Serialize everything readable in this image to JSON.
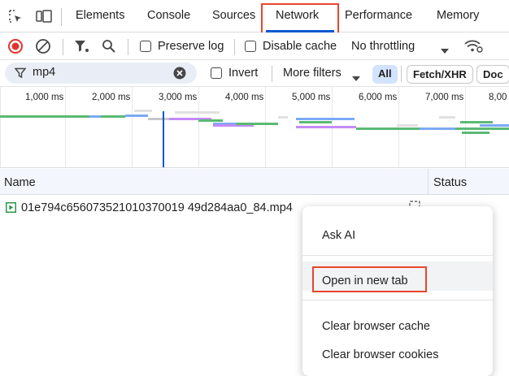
{
  "tabs": {
    "items": [
      {
        "label": "Elements"
      },
      {
        "label": "Console"
      },
      {
        "label": "Sources"
      },
      {
        "label": "Network"
      },
      {
        "label": "Performance"
      },
      {
        "label": "Memory"
      }
    ],
    "active": "Network"
  },
  "toolbar": {
    "preserve_log_label": "Preserve log",
    "preserve_log_checked": false,
    "disable_cache_label": "Disable cache",
    "disable_cache_checked": false,
    "throttling_value": "No throttling"
  },
  "filter": {
    "value": "mp4",
    "invert_label": "Invert",
    "invert_checked": false,
    "more_filters_label": "More filters",
    "types": [
      {
        "label": "All",
        "selected": true
      },
      {
        "label": "Fetch/XHR",
        "selected": false
      },
      {
        "label": "Doc",
        "selected": false
      }
    ]
  },
  "overview": {
    "ticks": [
      "1,000 ms",
      "2,000 ms",
      "3,000 ms",
      "4,000 ms",
      "5,000 ms",
      "6,000 ms",
      "7,000 ms",
      "8,00"
    ]
  },
  "table": {
    "columns": {
      "name": "Name",
      "status": "Status"
    },
    "rows": [
      {
        "name": "01e794c656073521010370019 49d284aa0_84.mp4"
      }
    ]
  },
  "context_menu": {
    "items": [
      {
        "label": "Ask AI"
      },
      {
        "label": "Open in new tab",
        "highlighted": true
      },
      {
        "label": "Clear browser cache"
      },
      {
        "label": "Clear browser cookies"
      }
    ]
  },
  "colors": {
    "accent": "#0b57d0",
    "highlight_box": "#e8452e",
    "record_red": "#dc362e",
    "bar_green": "#5bb974",
    "bar_blue": "#7baaf7",
    "bar_purple": "#c58af9",
    "bar_gray": "#c7c7c7"
  }
}
